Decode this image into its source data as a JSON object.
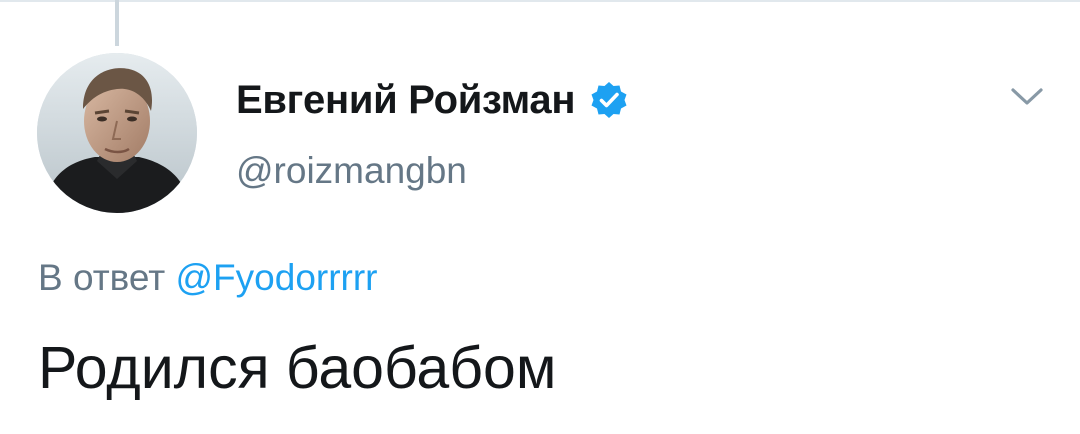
{
  "tweet": {
    "author": {
      "display_name": "Евгений Ройзман",
      "username": "@roizmangbn",
      "verified": true,
      "avatar_icon": "user-avatar-photo"
    },
    "reply": {
      "prefix": "В ответ",
      "mention": "@Fyodorrrrr"
    },
    "text": "Родился баобабом",
    "footer_partial": "",
    "menu_icon": "chevron-down-icon"
  },
  "colors": {
    "text_primary": "#14171a",
    "text_secondary": "#657786",
    "link": "#1da1f2",
    "verified_badge": "#1da1f2",
    "divider": "#e1e8ed",
    "thread_line": "#ccd6dd"
  }
}
